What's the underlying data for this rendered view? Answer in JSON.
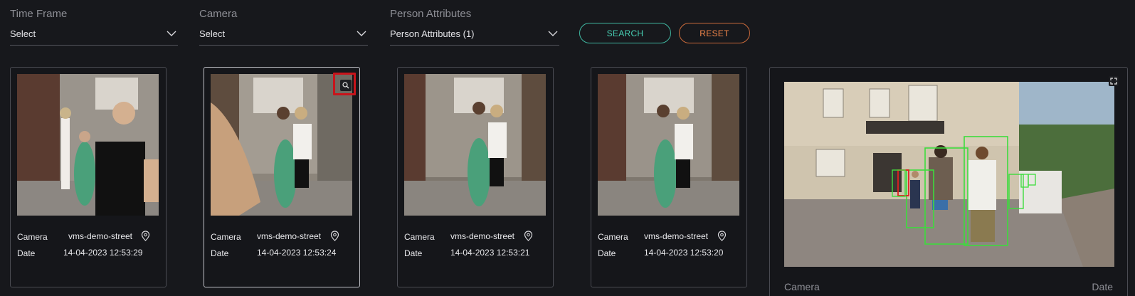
{
  "filters": [
    {
      "label": "Time Frame",
      "value": "Select"
    },
    {
      "label": "Camera",
      "value": "Select"
    },
    {
      "label": "Person Attributes",
      "value": "Person Attributes (1)"
    }
  ],
  "buttons": {
    "search": "SEARCH",
    "reset": "RESET"
  },
  "results": [
    {
      "camera_label": "Camera",
      "camera": "vms-demo-street",
      "date_label": "Date",
      "date": "14-04-2023 12:53:29"
    },
    {
      "camera_label": "Camera",
      "camera": "vms-demo-street",
      "date_label": "Date",
      "date": "14-04-2023 12:53:24"
    },
    {
      "camera_label": "Camera",
      "camera": "vms-demo-street",
      "date_label": "Date",
      "date": "14-04-2023 12:53:21"
    },
    {
      "camera_label": "Camera",
      "camera": "vms-demo-street",
      "date_label": "Date",
      "date": "14-04-2023 12:53:20"
    }
  ],
  "preview": {
    "camera_label": "Camera",
    "date_label": "Date"
  },
  "icons": {
    "chevron": "chevron-down-icon",
    "pin": "map-pin-icon",
    "zoom": "zoom-search-icon",
    "expand": "expand-icon"
  },
  "colors": {
    "search_accent": "#48d1b5",
    "reset_accent": "#f0854a",
    "highlight": "#c8141b",
    "detection_box": "#3ddc3d",
    "selected_box": "#e02020"
  }
}
